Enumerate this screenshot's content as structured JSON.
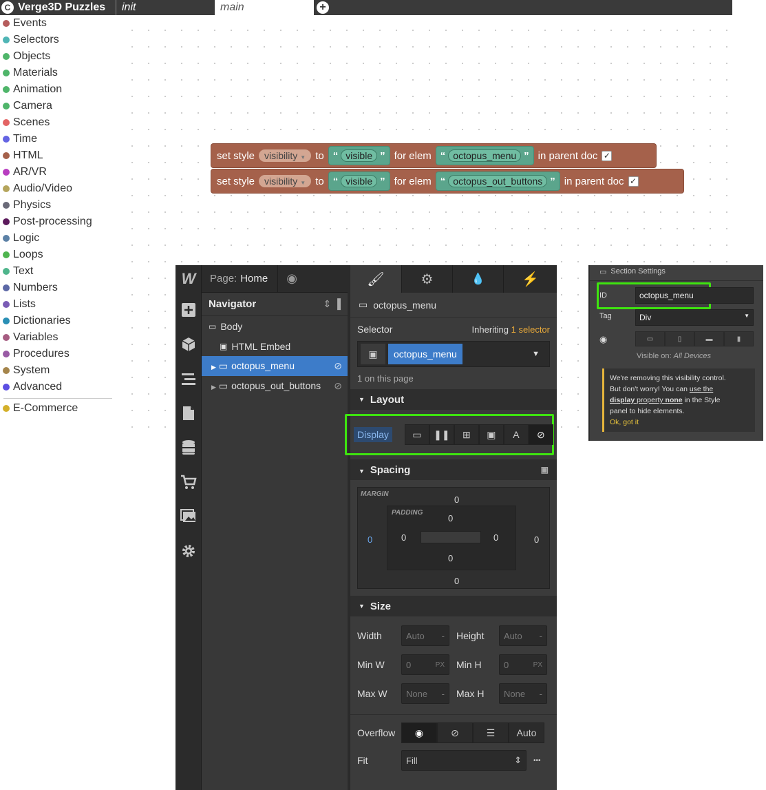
{
  "topbar": {
    "app_title": "Verge3D Puzzles",
    "logo_glyph": "C",
    "tabs": [
      {
        "label": "init"
      },
      {
        "label": "main"
      }
    ],
    "add_tab_glyph": "+"
  },
  "categories": [
    {
      "label": "Events",
      "color": "#b55c5c"
    },
    {
      "label": "Selectors",
      "color": "#4fb5b5"
    },
    {
      "label": "Objects",
      "color": "#4fb56a"
    },
    {
      "label": "Materials",
      "color": "#4fb56a"
    },
    {
      "label": "Animation",
      "color": "#4fb56a"
    },
    {
      "label": "Camera",
      "color": "#4fb56a"
    },
    {
      "label": "Scenes",
      "color": "#e36464"
    },
    {
      "label": "Time",
      "color": "#6464e3"
    },
    {
      "label": "HTML",
      "color": "#a5614b"
    },
    {
      "label": "AR/VR",
      "color": "#b83ec0"
    },
    {
      "label": "Audio/Video",
      "color": "#b5a55c"
    },
    {
      "label": "Physics",
      "color": "#6a6a78"
    },
    {
      "label": "Post-processing",
      "color": "#5c1a5c"
    },
    {
      "label": "Logic",
      "color": "#5c81a6"
    },
    {
      "label": "Loops",
      "color": "#4fb54f"
    },
    {
      "label": "Text",
      "color": "#4fb58c"
    },
    {
      "label": "Numbers",
      "color": "#5c68a6"
    },
    {
      "label": "Lists",
      "color": "#7a5cb5"
    },
    {
      "label": "Dictionaries",
      "color": "#2a8fb5"
    },
    {
      "label": "Variables",
      "color": "#a65c81"
    },
    {
      "label": "Procedures",
      "color": "#995ba5"
    },
    {
      "label": "System",
      "color": "#a5854b"
    },
    {
      "label": "Advanced",
      "color": "#5c4fe3"
    }
  ],
  "ecommerce": {
    "label": "E-Commerce",
    "color": "#d4b02a"
  },
  "blocks": [
    {
      "prefix": "set style",
      "property": "visibility",
      "to": "to",
      "value": "visible",
      "for_elem": "for elem",
      "elem": "octopus_menu",
      "parent": "in parent doc",
      "check": "✓"
    },
    {
      "prefix": "set style",
      "property": "visibility",
      "to": "to",
      "value": "visible",
      "for_elem": "for elem",
      "elem": "octopus_out_buttons",
      "parent": "in parent doc",
      "check": "✓"
    }
  ],
  "quote_open": "“",
  "quote_close": "”",
  "webflow": {
    "logo": "W",
    "page_label": "Page:",
    "page_name": "Home",
    "navigator_title": "Navigator",
    "nav_items": [
      {
        "label": "Body"
      },
      {
        "label": "HTML Embed"
      },
      {
        "label": "octopus_menu"
      },
      {
        "label": "octopus_out_buttons"
      }
    ],
    "element_name": "octopus_menu",
    "selector_label": "Selector",
    "inheriting_label": "Inheriting",
    "inheriting_count": "1 selector",
    "selector_chip": "octopus_menu",
    "on_page": "1 on this page",
    "layout_title": "Layout",
    "display_label": "Display",
    "spacing_title": "Spacing",
    "margin_label": "MARGIN",
    "padding_label": "PADDING",
    "margin": {
      "top": "0",
      "left": "0",
      "right": "0",
      "bottom": "0"
    },
    "padding": {
      "top": "0",
      "left": "0",
      "right": "0",
      "bottom": "0"
    },
    "size_title": "Size",
    "width_label": "Width",
    "width_value": "Auto",
    "height_label": "Height",
    "height_value": "Auto",
    "minw_label": "Min W",
    "minw_value": "0",
    "minh_label": "Min H",
    "minh_value": "0",
    "maxw_label": "Max W",
    "maxw_value": "None",
    "maxh_label": "Max H",
    "maxh_value": "None",
    "unit_px": "PX",
    "unit_dash": "-",
    "overflow_label": "Overflow",
    "overflow_auto": "Auto",
    "fit_label": "Fit",
    "fit_value": "Fill",
    "more": "•••"
  },
  "section_settings": {
    "title": "Section Settings",
    "id_label": "ID",
    "id_value": "octopus_menu",
    "tag_label": "Tag",
    "tag_value": "Div",
    "visible_on_label": "Visible on:",
    "visible_on_value": "All Devices",
    "notice_1": "We're removing this visibility control.",
    "notice_2a": "But don't worry! You can ",
    "notice_2_link": "use the",
    "notice_3_bold": "display",
    "notice_3_link": " property ",
    "notice_3_bold2": "none",
    "notice_3_rest": " in the Style",
    "notice_4": "panel to hide elements.",
    "ok": "Ok, got it"
  }
}
